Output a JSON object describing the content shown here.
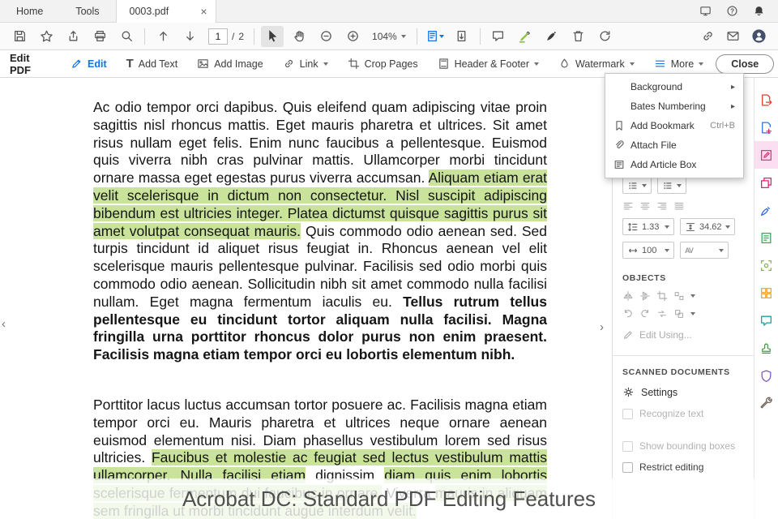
{
  "tab_bar": {
    "tabs": [
      {
        "label": "Home"
      },
      {
        "label": "Tools"
      },
      {
        "label": "0003.pdf",
        "active": true
      }
    ]
  },
  "toolbar": {
    "page_current": "1",
    "page_separator": "/",
    "page_total": "2",
    "zoom": "104%"
  },
  "edit_toolbar": {
    "title": "Edit PDF",
    "buttons": [
      {
        "label": "Edit"
      },
      {
        "label": "Add Text"
      },
      {
        "label": "Add Image"
      },
      {
        "label": "Link",
        "dropdown": true
      },
      {
        "label": "Crop Pages"
      },
      {
        "label": "Header & Footer",
        "dropdown": true
      },
      {
        "label": "Watermark",
        "dropdown": true
      },
      {
        "label": "More",
        "dropdown": true
      }
    ],
    "close_label": "Close"
  },
  "more_menu": {
    "items": [
      {
        "label": "Background",
        "submenu": true
      },
      {
        "label": "Bates Numbering",
        "submenu": true
      },
      {
        "label": "Add Bookmark",
        "shortcut": "Ctrl+B"
      },
      {
        "label": "Attach File"
      },
      {
        "label": "Add Article Box"
      }
    ]
  },
  "document": {
    "paragraphs": [
      {
        "segments": [
          {
            "text": "Ac odio tempor orci dapibus. Quis eleifend quam adipiscing vitae proin sagittis nisl rhoncus mattis. Eget mauris pharetra et ultrices. Sit amet risus nullam eget felis. Enim nunc faucibus a pellentesque. Euismod quis viverra nibh cras pulvinar mattis. Ullamcorper morbi tincidunt ornare massa eget egestas purus viverra accumsan. "
          },
          {
            "text": "Aliquam etiam erat velit scelerisque in dictum non consectetur. Nisl suscipit adipiscing bibendum est ultricies integer. Platea dictumst quisque sagittis purus sit amet volutpat consequat mauris.",
            "highlight": true
          },
          {
            "text": " Quis commodo odio aenean sed. Sed turpis tincidunt id aliquet risus feugiat in. Rhoncus aenean vel elit scelerisque mauris pellentesque pulvinar. Facilisis sed odio morbi quis commodo odio aenean. Sollicitudin nibh sit amet commodo nulla facilisi nullam. Eget magna fermentum iaculis eu. "
          },
          {
            "text": "Tellus rutrum tellus pellentesque eu tincidunt tortor aliquam nulla facilisi. Magna fringilla urna porttitor rhoncus dolor purus non enim praesent. Facilisis magna etiam tempor orci eu lobortis elementum nibh.",
            "bold": true
          }
        ]
      },
      {
        "segments": [
          {
            "text": "Porttitor lacus luctus accumsan tortor posuere ac. Facilisis magna etiam tempor orci eu. Mauris pharetra et ultrices neque ornare aenean euismod elementum nisi. Diam phasellus vestibulum lorem sed risus ultricies. "
          },
          {
            "text": "Faucibus et molestie ac feugiat sed lectus vestibulum mattis ullamcorper. Nulla facilisi etiam",
            "highlight": true
          },
          {
            "text": " dignissim "
          },
          {
            "text": "diam quis enim lobortis scelerisque fermentum dui faucibus in ornare.",
            "highlight": true
          },
          {
            "text": " Viverra "
          },
          {
            "text": "mauris in aliquam sem fringilla ut morbi tincidunt augue interdum velit.",
            "highlight": true
          }
        ]
      }
    ]
  },
  "right_panel": {
    "line_spacing": "1.33",
    "paragraph_spacing": "34.62",
    "horizontal_scale": "100",
    "objects_label": "OBJECTS",
    "edit_using_label": "Edit Using...",
    "scanned_label": "SCANNED DOCUMENTS",
    "settings_label": "Settings",
    "checkboxes": [
      {
        "label": "Recognize text",
        "disabled": true
      },
      {
        "label": "Show bounding boxes",
        "disabled": true
      },
      {
        "label": "Restrict editing",
        "disabled": false
      }
    ]
  },
  "caption": {
    "text": "Acrobat DC: Standard PDF Editing Features"
  },
  "colors": {
    "accent_blue": "#1473e6",
    "highlight_green": "#c9e39b",
    "edit_tool_pink": "#e5357e"
  }
}
